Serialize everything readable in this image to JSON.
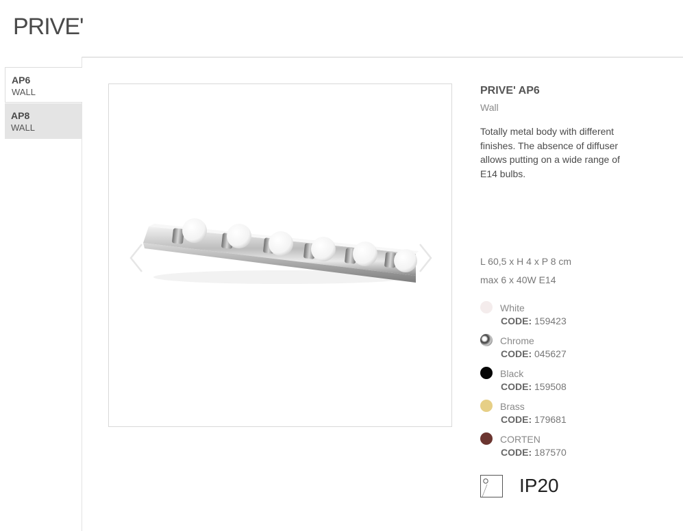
{
  "page": {
    "title": "PRIVE'"
  },
  "sidebar": {
    "items": [
      {
        "code": "AP6",
        "type": "WALL",
        "active": true
      },
      {
        "code": "AP8",
        "type": "WALL",
        "active": false
      }
    ]
  },
  "product": {
    "name": "PRIVE' AP6",
    "type": "Wall",
    "description": "Totally metal body with different finishes. The absence of diffuser allows putting on a wide range of E14 bulbs.",
    "dimensions": "L 60,5 x H 4 x P 8 cm",
    "power": "max 6 x 40W E14",
    "ip_rating": "IP20"
  },
  "finishes": [
    {
      "name": "White",
      "code_label": "CODE:",
      "code": "159423",
      "color": "#f4ecec"
    },
    {
      "name": "Chrome",
      "code_label": "CODE:",
      "code": "045627",
      "color": "#3a3a3a"
    },
    {
      "name": "Black",
      "code_label": "CODE:",
      "code": "159508",
      "color": "#050505"
    },
    {
      "name": "Brass",
      "code_label": "CODE:",
      "code": "179681",
      "color": "#e6cf86"
    },
    {
      "name": "CORTEN",
      "code_label": "CODE:",
      "code": "187570",
      "color": "#6b3530"
    }
  ],
  "gallery": {
    "prev_icon": "chevron-left-icon",
    "next_icon": "chevron-right-icon",
    "image": "wall-lamp-six-bulbs"
  }
}
